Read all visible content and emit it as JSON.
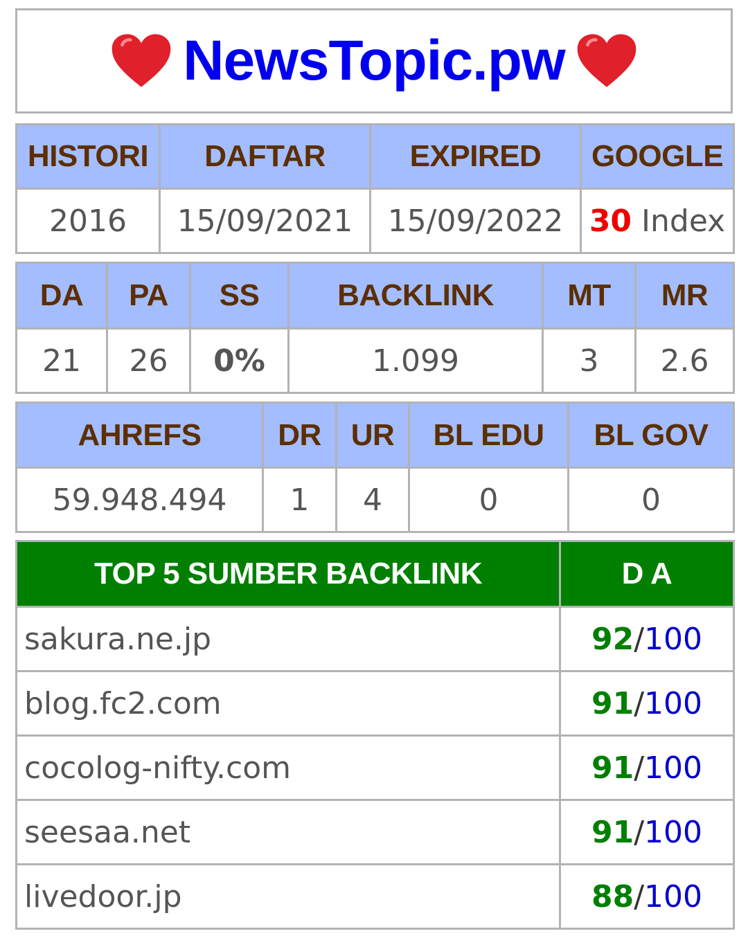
{
  "header": {
    "title": "NewsTopic.pw",
    "heart_icon": "heart-icon",
    "title_color": "#0000ee"
  },
  "colors": {
    "header_bg": "#a3bdff",
    "header_text": "#5c2e00",
    "top_header_bg": "#007f00"
  },
  "table1": {
    "headers": [
      "HISTORI",
      "DAFTAR",
      "EXPIRED",
      "GOOGLE"
    ],
    "histori": "2016",
    "daftar": "15/09/2021",
    "expired": "15/09/2022",
    "google_count": "30",
    "google_suffix": " Index"
  },
  "table2": {
    "headers": [
      "DA",
      "PA",
      "SS",
      "BACKLINK",
      "MT",
      "MR"
    ],
    "values": [
      "21",
      "26",
      "0%",
      "1.099",
      "3",
      "2.6"
    ]
  },
  "table3": {
    "headers": [
      "AHREFS",
      "DR",
      "UR",
      "BL EDU",
      "BL GOV"
    ],
    "values": [
      "59.948.494",
      "1",
      "4",
      "0",
      "0"
    ]
  },
  "top_backlinks": {
    "header_source": "TOP 5 SUMBER BACKLINK",
    "header_da": "D A",
    "slash": "/",
    "rows": [
      {
        "site": "sakura.ne.jp",
        "da": "92",
        "max": "100"
      },
      {
        "site": "blog.fc2.com",
        "da": "91",
        "max": "100"
      },
      {
        "site": "cocolog-nifty.com",
        "da": "91",
        "max": "100"
      },
      {
        "site": "seesaa.net",
        "da": "91",
        "max": "100"
      },
      {
        "site": "livedoor.jp",
        "da": "88",
        "max": "100"
      }
    ]
  }
}
